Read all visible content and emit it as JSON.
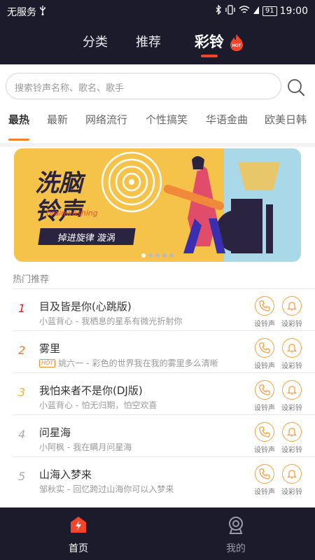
{
  "status_bar": {
    "carrier": "无服务",
    "battery": "91",
    "time": "19:00"
  },
  "top_nav": {
    "tabs": [
      {
        "label": "分类"
      },
      {
        "label": "推荐"
      },
      {
        "label": "彩铃",
        "active": true
      }
    ],
    "hot_label": "HOT"
  },
  "search": {
    "placeholder": "搜索铃声名称、歌名、歌手"
  },
  "categories": [
    {
      "label": "最热",
      "active": true
    },
    {
      "label": "最新"
    },
    {
      "label": "网络流行"
    },
    {
      "label": "个性搞笑"
    },
    {
      "label": "华语金曲"
    },
    {
      "label": "欧美日韩"
    }
  ],
  "banner": {
    "title_line1": "洗脑",
    "title_line2": "铃声",
    "script": "brainwashing",
    "subtitle": "掉进旋律  漩涡",
    "active_dot": 1,
    "dot_count": 5
  },
  "section_title": "热门推荐",
  "songs": [
    {
      "rank": "1",
      "title": "目及皆是你(心跳版)",
      "artist": "小蓝背心",
      "desc": "我栖息的星系有微光折射你",
      "hot": false,
      "rank_color": "#e02020"
    },
    {
      "rank": "2",
      "title": "雾里",
      "artist": "姚六一",
      "desc": "彩色的世界我在我的雾里多么清晰",
      "hot": true,
      "rank_color": "#f07a22"
    },
    {
      "rank": "3",
      "title": "我怕来者不是你(DJ版)",
      "artist": "小蓝背心",
      "desc": "怕无归期，怕空欢喜",
      "hot": false,
      "rank_color": "#f2b22a"
    },
    {
      "rank": "4",
      "title": "问星海",
      "artist": "小阿枫",
      "desc": "我在瞒月问星海",
      "hot": false,
      "rank_color": "#aaaaaa"
    },
    {
      "rank": "5",
      "title": "山海入梦来",
      "artist": "邹秋实",
      "desc": "回忆跨过山海你可以入梦来",
      "hot": false,
      "rank_color": "#aaaaaa"
    }
  ],
  "actions": {
    "set_ringtone": "设铃声",
    "set_color_ring": "设彩铃"
  },
  "bottom_nav": {
    "home": "首页",
    "mine": "我的"
  },
  "colors": {
    "bg_dark": "#1c1b2b",
    "accent": "#f2452b",
    "orange": "#f5a142"
  }
}
